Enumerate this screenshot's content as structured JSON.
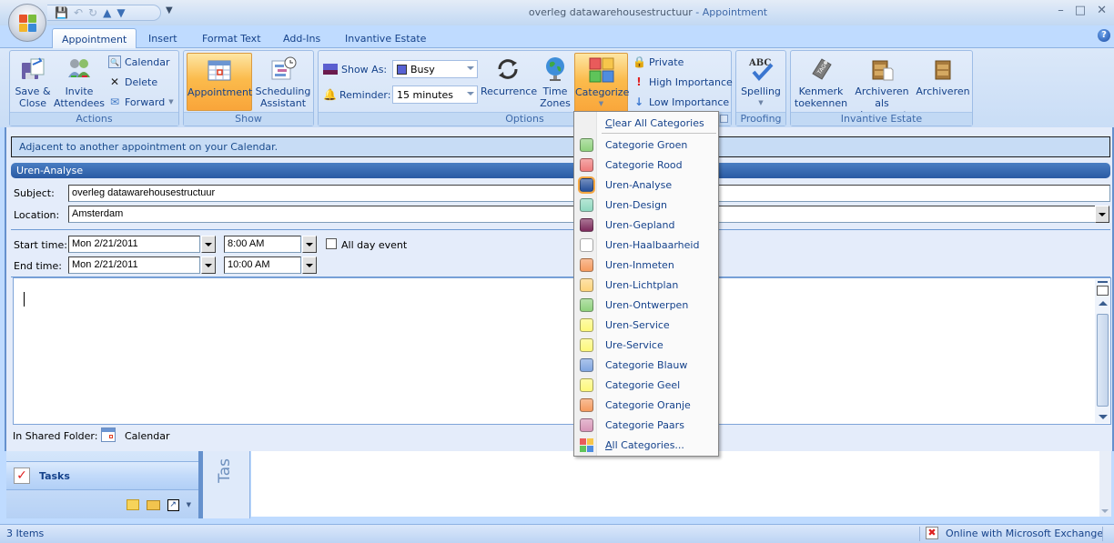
{
  "window": {
    "title_doc": "overleg datawarehousestructuur",
    "title_sep": " - ",
    "title_type": "Appointment",
    "controls": [
      "minimize-icon",
      "maximize-icon",
      "close-icon"
    ]
  },
  "quick_access": [
    "save-icon",
    "undo-icon",
    "redo-icon",
    "previous-item-icon",
    "next-item-icon"
  ],
  "tabs": [
    {
      "label": "Appointment",
      "active": true
    },
    {
      "label": "Insert"
    },
    {
      "label": "Format Text"
    },
    {
      "label": "Add-Ins"
    },
    {
      "label": "Invantive Estate"
    }
  ],
  "ribbon": {
    "actions": {
      "label": "Actions",
      "save_close": "Save &\nClose",
      "save_l1": "Save &",
      "save_l2": "Close",
      "invite_l1": "Invite",
      "invite_l2": "Attendees",
      "calendar": "Calendar",
      "delete": "Delete",
      "forward": "Forward"
    },
    "show": {
      "label": "Show",
      "appointment": "Appointment",
      "sched_l1": "Scheduling",
      "sched_l2": "Assistant"
    },
    "options": {
      "label": "Options",
      "show_as_label": "Show As:",
      "show_as_value": "Busy",
      "reminder_label": "Reminder:",
      "reminder_value": "15 minutes",
      "recurrence": "Recurrence",
      "tz_l1": "Time",
      "tz_l2": "Zones",
      "categorize": "Categorize",
      "private": "Private",
      "high": "High Importance",
      "low": "Low Importance"
    },
    "proofing": {
      "label": "Proofing",
      "spelling": "Spelling"
    },
    "invantive": {
      "label": "Invantive Estate",
      "kenmerk_l1": "Kenmerk",
      "kenmerk_l2": "toekennen",
      "archdoc_l1": "Archiveren",
      "archdoc_l2": "als document",
      "archiveren": "Archiveren"
    }
  },
  "form": {
    "info": "Adjacent to another appointment on your Calendar.",
    "category_banner": "Uren-Analyse",
    "category_color": "#2a5aa3",
    "subject_label": "Subject:",
    "subject_value": "overleg datawarehousestructuur",
    "location_label": "Location:",
    "location_value": "Amsterdam",
    "start_label": "Start time:",
    "start_date": "Mon 2/21/2011",
    "start_time": "8:00 AM",
    "all_day_label": "All day event",
    "all_day_checked": false,
    "end_label": "End time:",
    "end_date": "Mon 2/21/2011",
    "end_time": "10:00 AM",
    "body_text": "",
    "shared_folder_label": "In Shared Folder:",
    "shared_folder_value": "Calendar"
  },
  "categorize_menu": {
    "clear_prefix": "C",
    "clear_rest": "lear All Categories",
    "items": [
      {
        "label": "Categorie Groen",
        "color": "#8ed17c"
      },
      {
        "label": "Categorie Rood",
        "color": "#ee7a7a"
      },
      {
        "label": "Uren-Analyse",
        "color": "#27519b",
        "selected": true
      },
      {
        "label": "Uren-Design",
        "color": "#8fd8bf"
      },
      {
        "label": "Uren-Gepland",
        "color": "#7d2b5c"
      },
      {
        "label": "Uren-Haalbaarheid",
        "color": "#ffffff"
      },
      {
        "label": "Uren-Inmeten",
        "color": "#f59a5e"
      },
      {
        "label": "Uren-Lichtplan",
        "color": "#fdd37a"
      },
      {
        "label": "Uren-Ontwerpen",
        "color": "#8ed17c"
      },
      {
        "label": "Uren-Service",
        "color": "#fdf87a"
      },
      {
        "label": "Ure-Service",
        "color": "#fdf87a"
      },
      {
        "label": "Categorie Blauw",
        "color": "#7fa5e0"
      },
      {
        "label": "Categorie Geel",
        "color": "#fdf87a"
      },
      {
        "label": "Categorie Oranje",
        "color": "#f59a5e"
      },
      {
        "label": "Categorie Paars",
        "color": "#d795b8"
      }
    ],
    "all_prefix": "A",
    "all_rest": "ll Categories..."
  },
  "nav": {
    "tasks_label": "Tasks",
    "todo_bar_label": "Tas"
  },
  "status": {
    "items": "3 Items",
    "connection": "Online with Microsoft Exchange"
  }
}
